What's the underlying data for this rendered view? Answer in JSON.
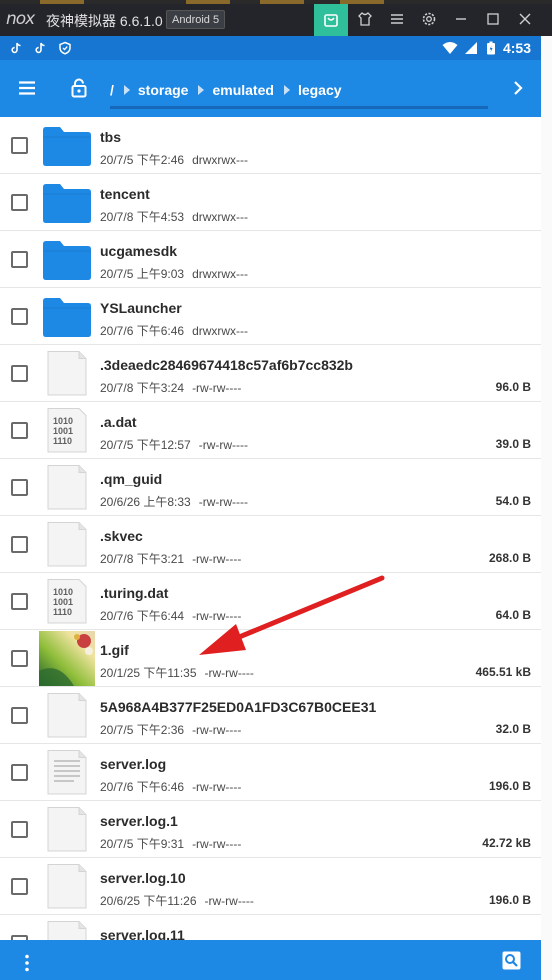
{
  "emulator": {
    "app_name": "夜神模拟器 6.6.1.0",
    "android_badge": "Android 5",
    "logo_text": "nox",
    "buttons": [
      "store-icon",
      "shirt-icon",
      "menu-icon",
      "settings-icon",
      "minimize-icon",
      "maximize-icon",
      "close-icon"
    ]
  },
  "status_bar": {
    "time": "4:53",
    "icons": [
      "tiktok-icon",
      "tiktok-icon",
      "shield-icon",
      "wifi-icon",
      "signal-icon",
      "battery-icon"
    ]
  },
  "toolbar": {
    "breadcrumbs": [
      "/",
      "storage",
      "emulated",
      "legacy"
    ],
    "accent": "#1e88e5"
  },
  "files": [
    {
      "name": "tbs",
      "date": "20/7/5 下午2:46",
      "perm": "drwxrwx---",
      "size": "",
      "type": "folder"
    },
    {
      "name": "tencent",
      "date": "20/7/8 下午4:53",
      "perm": "drwxrwx---",
      "size": "",
      "type": "folder"
    },
    {
      "name": "ucgamesdk",
      "date": "20/7/5 上午9:03",
      "perm": "drwxrwx---",
      "size": "",
      "type": "folder"
    },
    {
      "name": "YSLauncher",
      "date": "20/7/6 下午6:46",
      "perm": "drwxrwx---",
      "size": "",
      "type": "folder"
    },
    {
      "name": ".3deaedc28469674418c57af6b7cc832b",
      "date": "20/7/8 下午3:24",
      "perm": "-rw-rw----",
      "size": "96.0 B",
      "type": "file"
    },
    {
      "name": ".a.dat",
      "date": "20/7/5 下午12:57",
      "perm": "-rw-rw----",
      "size": "39.0 B",
      "type": "binary"
    },
    {
      "name": ".qm_guid",
      "date": "20/6/26 上午8:33",
      "perm": "-rw-rw----",
      "size": "54.0 B",
      "type": "file"
    },
    {
      "name": ".skvec",
      "date": "20/7/8 下午3:21",
      "perm": "-rw-rw----",
      "size": "268.0 B",
      "type": "file"
    },
    {
      "name": ".turing.dat",
      "date": "20/7/6 下午6:44",
      "perm": "-rw-rw----",
      "size": "64.0 B",
      "type": "binary"
    },
    {
      "name": "1.gif",
      "date": "20/1/25 下午11:35",
      "perm": "-rw-rw----",
      "size": "465.51 kB",
      "type": "image"
    },
    {
      "name": "5A968A4B377F25ED0A1FD3C67B0CEE31",
      "date": "20/7/5 下午2:36",
      "perm": "-rw-rw----",
      "size": "32.0 B",
      "type": "file"
    },
    {
      "name": "server.log",
      "date": "20/7/6 下午6:46",
      "perm": "-rw-rw----",
      "size": "196.0 B",
      "type": "text"
    },
    {
      "name": "server.log.1",
      "date": "20/7/5 下午9:31",
      "perm": "-rw-rw----",
      "size": "42.72 kB",
      "type": "file"
    },
    {
      "name": "server.log.10",
      "date": "20/6/25 下午11:26",
      "perm": "-rw-rw----",
      "size": "196.0 B",
      "type": "file"
    },
    {
      "name": "server.log.11",
      "date": "",
      "perm": "",
      "size": "",
      "type": "file"
    }
  ],
  "binary_icon_text": [
    "1010",
    "1001",
    "1110"
  ],
  "bottom_bar": {
    "icons": [
      "more-vert-icon",
      "search-icon"
    ]
  }
}
